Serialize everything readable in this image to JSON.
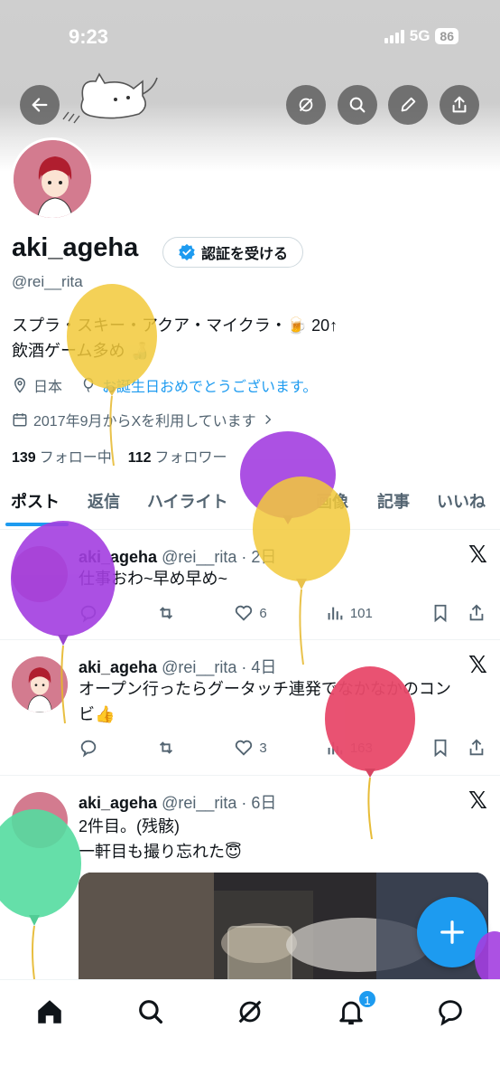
{
  "status": {
    "time": "9:23",
    "network": "5G",
    "battery": "86"
  },
  "profile": {
    "name": "aki_ageha",
    "verify_label": "認証を受ける",
    "handle": "@rei__rita",
    "bio_line1": "スプラ・スキー・アクア・マイクラ・🍺 20↑",
    "bio_line2": "飲酒ゲーム多め 🍶",
    "location": "日本",
    "birthday": "お誕生日おめでとうございます。",
    "joined": "2017年9月からXを利用しています",
    "following_count": "139",
    "following_label": "フォロー中",
    "followers_count": "112",
    "followers_label": "フォロワー"
  },
  "tabs": [
    "ポスト",
    "返信",
    "ハイライト",
    "画像",
    "記事",
    "いいね"
  ],
  "posts": [
    {
      "name": "aki_ageha",
      "meta": "@rei__rita · 2日",
      "text_line1": "仕事おわ~早め早め~",
      "text_line2": "",
      "replies": "",
      "retweets": "",
      "likes": "6",
      "views": "101"
    },
    {
      "name": "aki_ageha",
      "meta": "@rei__rita · 4日",
      "text_line1": "オープン行ったらグータッチ連発でなかなかのコン",
      "text_line2": "ビ👍",
      "replies": "",
      "retweets": "",
      "likes": "3",
      "views": "163"
    },
    {
      "name": "aki_ageha",
      "meta": "@rei__rita · 6日",
      "text_line1": "2件目。(残骸)",
      "text_line2": "一軒目も撮り忘れた😇"
    }
  ],
  "notification_badge": "1",
  "colors": {
    "accent": "#1d9bf0",
    "avatar_bg": "#d37b8f"
  }
}
